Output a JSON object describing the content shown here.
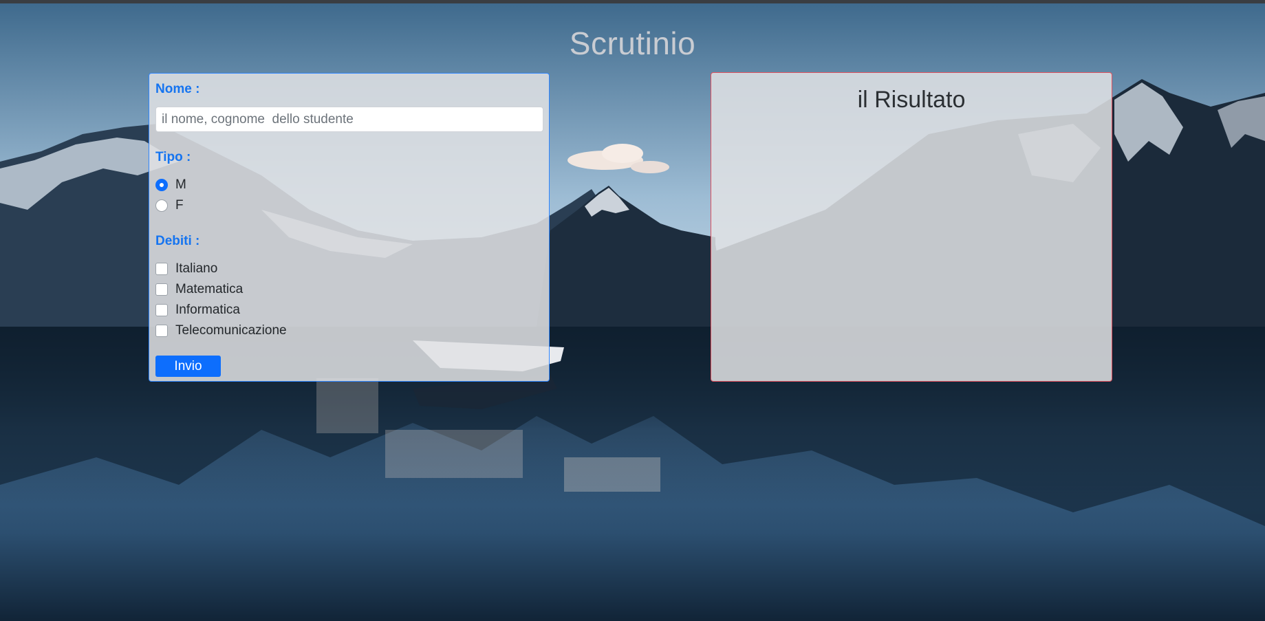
{
  "page": {
    "title": "Scrutinio"
  },
  "form": {
    "name_label": "Nome :",
    "name_placeholder": "il nome, cognome  dello studente",
    "name_value": "",
    "type_label": "Tipo :",
    "type_options": [
      {
        "label": "M",
        "checked": true
      },
      {
        "label": "F",
        "checked": false
      }
    ],
    "debts_label": "Debiti :",
    "debts_options": [
      {
        "label": "Italiano",
        "checked": false
      },
      {
        "label": "Matematica",
        "checked": false
      },
      {
        "label": "Informatica",
        "checked": false
      },
      {
        "label": "Telecomunicazione",
        "checked": false
      }
    ],
    "submit_label": "Invio"
  },
  "result": {
    "title": "il Risultato"
  },
  "colors": {
    "accent": "#0d6efd",
    "label": "#1574f0",
    "form_border": "#2f86ff",
    "result_border": "#e0505e",
    "title": "#c9ccd2"
  }
}
